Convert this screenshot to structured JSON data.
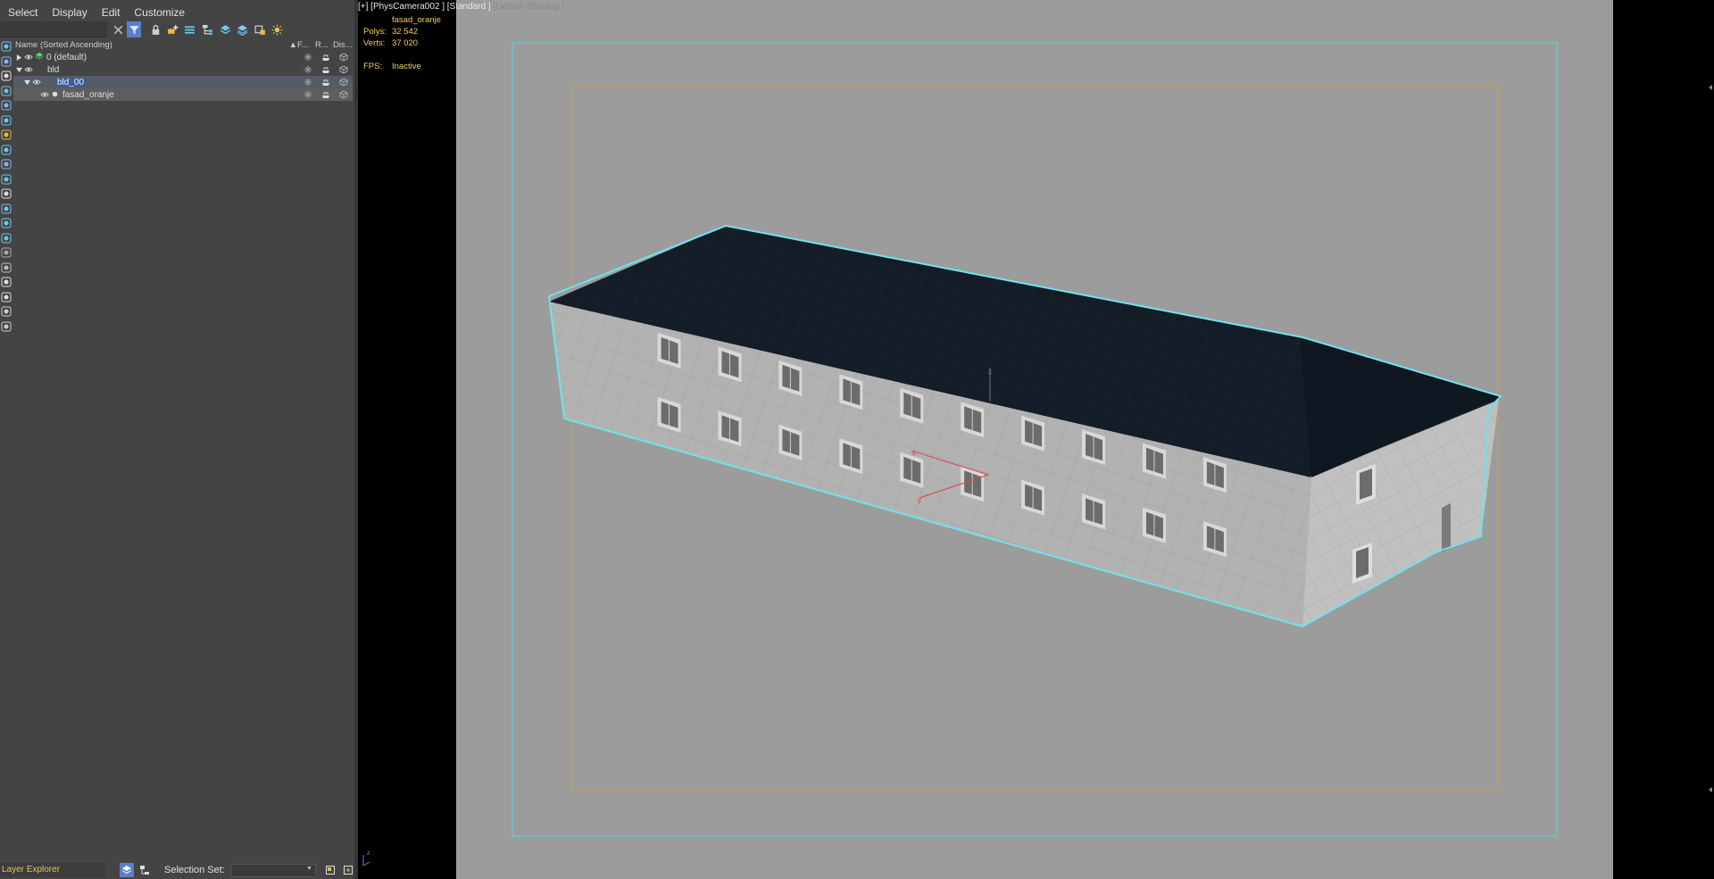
{
  "menu": [
    "Select",
    "Display",
    "Edit",
    "Customize"
  ],
  "toolbar_icons": [
    "close-filter-icon",
    "filter-icon",
    "lock-icon",
    "create-layer-icon",
    "layer-stack-icon",
    "hierarchy-icon",
    "layers-icon",
    "layers-alt-icon",
    "layer-props-icon",
    "sun-icon"
  ],
  "tree": {
    "header": {
      "name": "Name (Sorted Ascending)",
      "sort": "▲",
      "col_f": "F...",
      "col_r": "R...",
      "col_d": "Dis..."
    },
    "rows": [
      {
        "label": "0 (default)",
        "depth": 0,
        "expanded": false,
        "type": "layer-default"
      },
      {
        "label": "bld",
        "depth": 0,
        "expanded": true,
        "type": "layer"
      },
      {
        "label": "bld_00",
        "depth": 1,
        "expanded": true,
        "type": "layer",
        "selected": "blue"
      },
      {
        "label": "fasad_oranje",
        "depth": 2,
        "expanded": false,
        "type": "object",
        "selected": "gray"
      }
    ]
  },
  "bottom": {
    "explorer_name": "Layer Explorer",
    "selection_set_label": "Selection Set:",
    "selection_set_value": ""
  },
  "viewport": {
    "label_main": "[+] [PhysCamera002 ] [Standard ]",
    "label_dim": "[Default Shading ]",
    "object_name": "fasad_oranje",
    "polys_label": "Polys:",
    "polys_value": "32 542",
    "verts_label": "Verts:",
    "verts_value": "37 020",
    "fps_label": "FPS:",
    "fps_value": "Inactive",
    "axis_z": "z",
    "axis_y": "y",
    "axis_x": "x"
  },
  "colors": {
    "selection_outline": "#6fe3ee",
    "safe_frame_inner": "#c9a24a",
    "safe_frame_outer": "#5ed2de",
    "roof": "#131c27",
    "stat_text": "#f0d060"
  }
}
